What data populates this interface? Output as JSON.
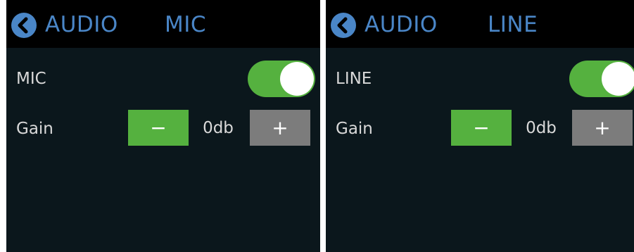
{
  "accent_color": "#4a86c7",
  "toggle_color": "#55b13f",
  "panels": [
    {
      "header": {
        "back_icon": "chevron-left-circle-icon",
        "section": "AUDIO",
        "title": "MIC"
      },
      "toggle": {
        "label": "MIC",
        "state": "on"
      },
      "gain": {
        "label": "Gain",
        "value": "0db",
        "minus": "−",
        "plus": "+"
      }
    },
    {
      "header": {
        "back_icon": "chevron-left-circle-icon",
        "section": "AUDIO",
        "title": "LINE"
      },
      "toggle": {
        "label": "LINE",
        "state": "on"
      },
      "gain": {
        "label": "Gain",
        "value": "0db",
        "minus": "−",
        "plus": "+"
      }
    }
  ]
}
